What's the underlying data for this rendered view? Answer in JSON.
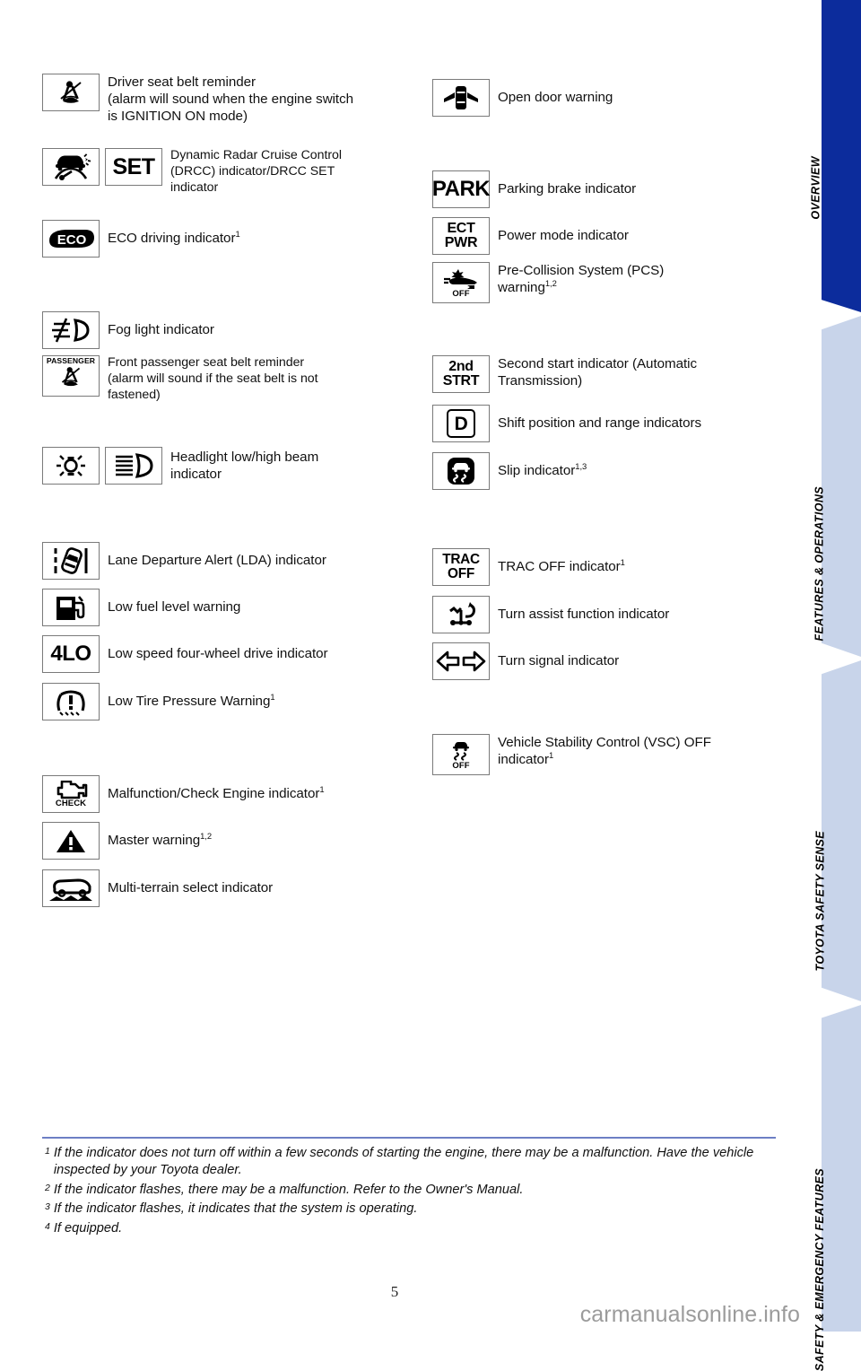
{
  "page": {
    "number": "5",
    "watermark": "carmanualsonline.info"
  },
  "rail": {
    "tabs": [
      {
        "label": "OVERVIEW",
        "color": "#0c2c9c",
        "active": true
      },
      {
        "label": "FEATURES & OPERATIONS",
        "color": "#c8d4ea",
        "active": false
      },
      {
        "label": "TOYOTA SAFETY SENSE",
        "color": "#c8d4ea",
        "active": false
      },
      {
        "label": "SAFETY & EMERGENCY FEATURES",
        "color": "#c8d4ea",
        "active": false
      }
    ]
  },
  "left_column": [
    {
      "icons": [
        "driver-seat-belt-reminder-icon"
      ],
      "text": "Driver seat belt reminder (alarm will sound when the engine switch is IGNITION ON mode)",
      "lines": [
        "Driver seat belt reminder",
        "(alarm will sound when the engine switch",
        "is IGNITION ON mode)"
      ]
    },
    {
      "icons": [
        "drcc-icon",
        "set-icon"
      ],
      "glyph": "SET",
      "text": "Dynamic Radar Cruise Control (DRCC) indicator/DRCC SET indicator",
      "lines": [
        "Dynamic Radar Cruise Control",
        "(DRCC) indicator/DRCC SET",
        "indicator"
      ]
    },
    {
      "icons": [
        "eco-driving-icon"
      ],
      "glyph": "ECO",
      "text": "ECO driving indicator",
      "footnote": "1"
    },
    {
      "icons": [
        "fog-light-icon"
      ],
      "text": "Fog light indicator"
    },
    {
      "icons": [
        "front-passenger-seat-belt-reminder-icon"
      ],
      "glyph": "PASSENGER",
      "text": "Front passenger seat belt reminder (alarm will sound if the seat belt is not fastened)",
      "lines": [
        "Front passenger seat belt reminder",
        "(alarm will sound if the seat belt is not",
        "fastened)"
      ]
    },
    {
      "icons": [
        "headlight-low-beam-icon",
        "headlight-high-beam-icon"
      ],
      "text": "Headlight low/high beam indicator",
      "lines": [
        "Headlight low/high beam",
        "indicator"
      ]
    },
    {
      "icons": [
        "lane-departure-alert-icon"
      ],
      "text": "Lane Departure Alert (LDA) indicator"
    },
    {
      "icons": [
        "low-fuel-level-icon"
      ],
      "text": "Low fuel level warning"
    },
    {
      "icons": [
        "four-low-icon"
      ],
      "glyph": "4LO",
      "text": "Low speed four-wheel drive indicator"
    },
    {
      "icons": [
        "low-tire-pressure-icon"
      ],
      "text": "Low Tire Pressure Warning",
      "footnote": "1"
    },
    {
      "icons": [
        "check-engine-icon"
      ],
      "glyph": "CHECK",
      "text": "Malfunction/Check Engine indicator",
      "footnote": "1"
    },
    {
      "icons": [
        "master-warning-icon"
      ],
      "text": "Master warning",
      "footnote": "1,2"
    },
    {
      "icons": [
        "multi-terrain-select-icon"
      ],
      "text": "Multi-terrain select indicator"
    }
  ],
  "right_column": [
    {
      "icons": [
        "open-door-warning-icon"
      ],
      "text": "Open door warning"
    },
    {
      "icons": [
        "parking-brake-icon"
      ],
      "glyph": "PARK",
      "text": "Parking brake indicator"
    },
    {
      "icons": [
        "power-mode-icon"
      ],
      "glyph": "ECT PWR",
      "text": "Power mode indicator"
    },
    {
      "icons": [
        "pre-collision-system-off-icon"
      ],
      "glyph": "OFF",
      "text": "Pre-Collision System (PCS) warning",
      "footnote": "1,2",
      "lines": [
        "Pre-Collision System (PCS)",
        "warning"
      ]
    },
    {
      "icons": [
        "second-start-icon"
      ],
      "glyph": "2nd STRT",
      "text": "Second start indicator (Automatic Transmission)",
      "lines": [
        "Second start indicator (Automatic",
        "Transmission)"
      ]
    },
    {
      "icons": [
        "shift-position-icon"
      ],
      "glyph": "D",
      "text": "Shift position and range indicators"
    },
    {
      "icons": [
        "slip-indicator-icon"
      ],
      "text": "Slip indicator",
      "footnote": "1,3"
    },
    {
      "icons": [
        "trac-off-icon"
      ],
      "glyph": "TRAC OFF",
      "text": "TRAC OFF indicator",
      "footnote": "1"
    },
    {
      "icons": [
        "turn-assist-function-icon"
      ],
      "text": "Turn assist function indicator"
    },
    {
      "icons": [
        "turn-signal-icon"
      ],
      "text": "Turn signal indicator"
    },
    {
      "icons": [
        "vsc-off-icon"
      ],
      "glyph": "OFF",
      "text": "Vehicle Stability Control (VSC) OFF indicator",
      "footnote": "1",
      "lines": [
        "Vehicle Stability Control (VSC) OFF",
        "indicator"
      ]
    }
  ],
  "footnotes": [
    {
      "marker": "1",
      "text": "If the indicator does not turn off within a few seconds of starting the engine, there may be a malfunction. Have the vehicle inspected by your Toyota dealer."
    },
    {
      "marker": "2",
      "text": "If the indicator flashes, there may be a malfunction. Refer to the Owner's Manual."
    },
    {
      "marker": "3",
      "text": "If the indicator flashes, it indicates that the system is operating."
    },
    {
      "marker": "4",
      "text": "If equipped."
    }
  ]
}
